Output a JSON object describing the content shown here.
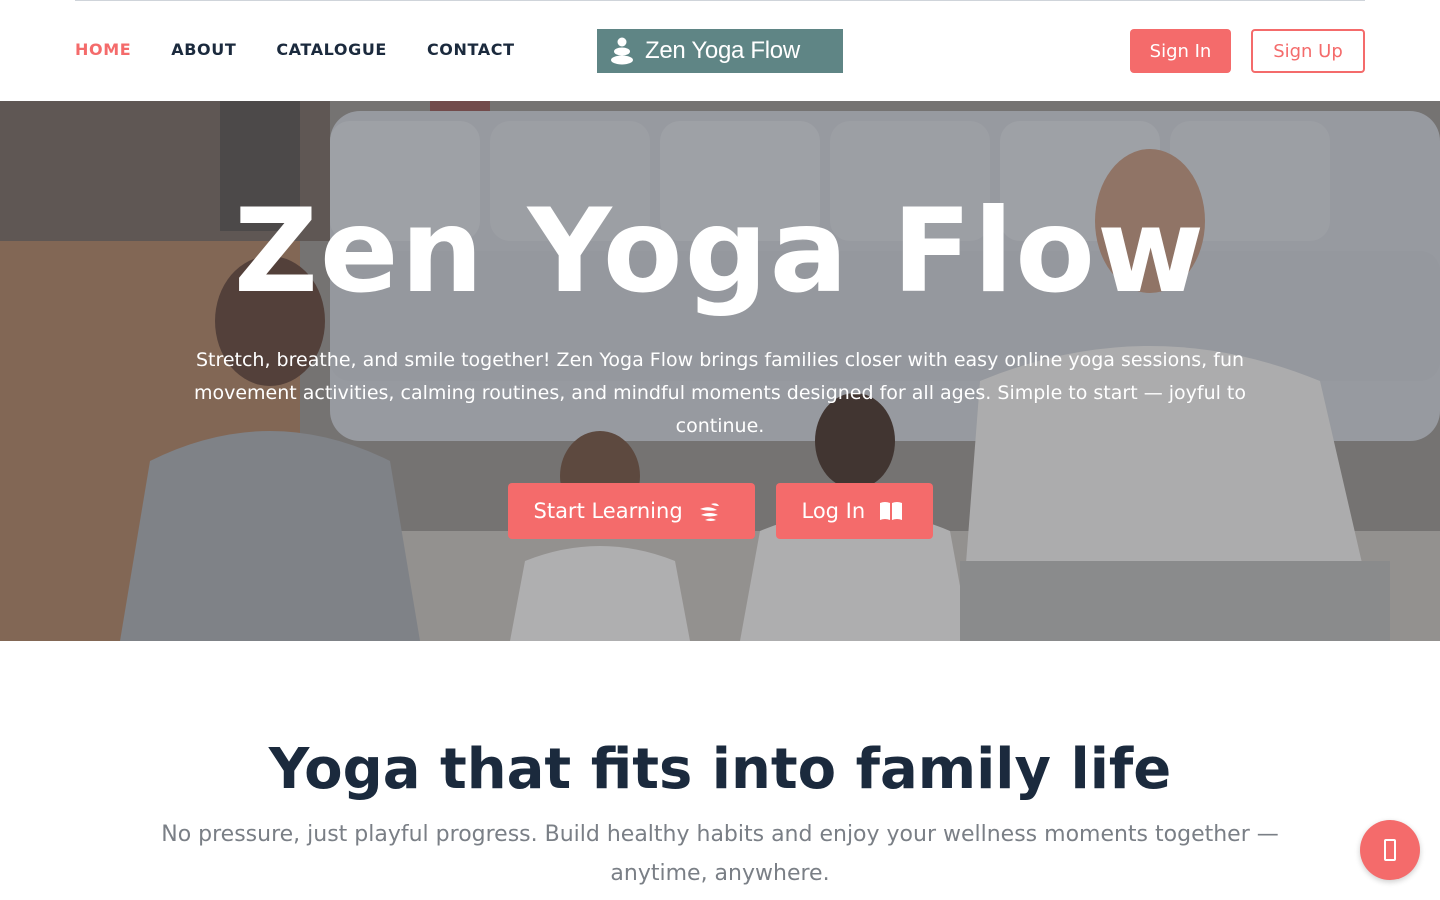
{
  "header": {
    "nav": [
      {
        "label": "HOME",
        "active": true
      },
      {
        "label": "ABOUT",
        "active": false
      },
      {
        "label": "CATALOGUE",
        "active": false
      },
      {
        "label": "CONTACT",
        "active": false
      }
    ],
    "logo_text": "Zen Yoga Flow",
    "logo_icon": "stacked-stones-icon",
    "sign_in_label": "Sign In",
    "sign_up_label": "Sign Up"
  },
  "hero": {
    "title": "Zen Yoga Flow",
    "description": "Stretch, breathe, and smile together! Zen Yoga Flow brings families closer with easy online yoga sessions, fun movement activities, calming routines, and mindful moments designed for all ages. Simple to start — joyful to continue.",
    "start_button": {
      "label": "Start Learning",
      "icon": "spa-icon"
    },
    "login_button": {
      "label": "Log In",
      "icon": "open-book-icon"
    }
  },
  "section": {
    "title": "Yoga that fits into family life",
    "subtitle": "No pressure, just playful progress. Build healthy habits and enjoy your wellness moments together — anytime, anywhere."
  },
  "chat_button": {
    "icon": "chat-icon"
  },
  "colors": {
    "accent": "#f46b6b",
    "logo_bg": "#5f8585",
    "heading": "#1b2a3d",
    "muted_text": "#7a7f86"
  }
}
